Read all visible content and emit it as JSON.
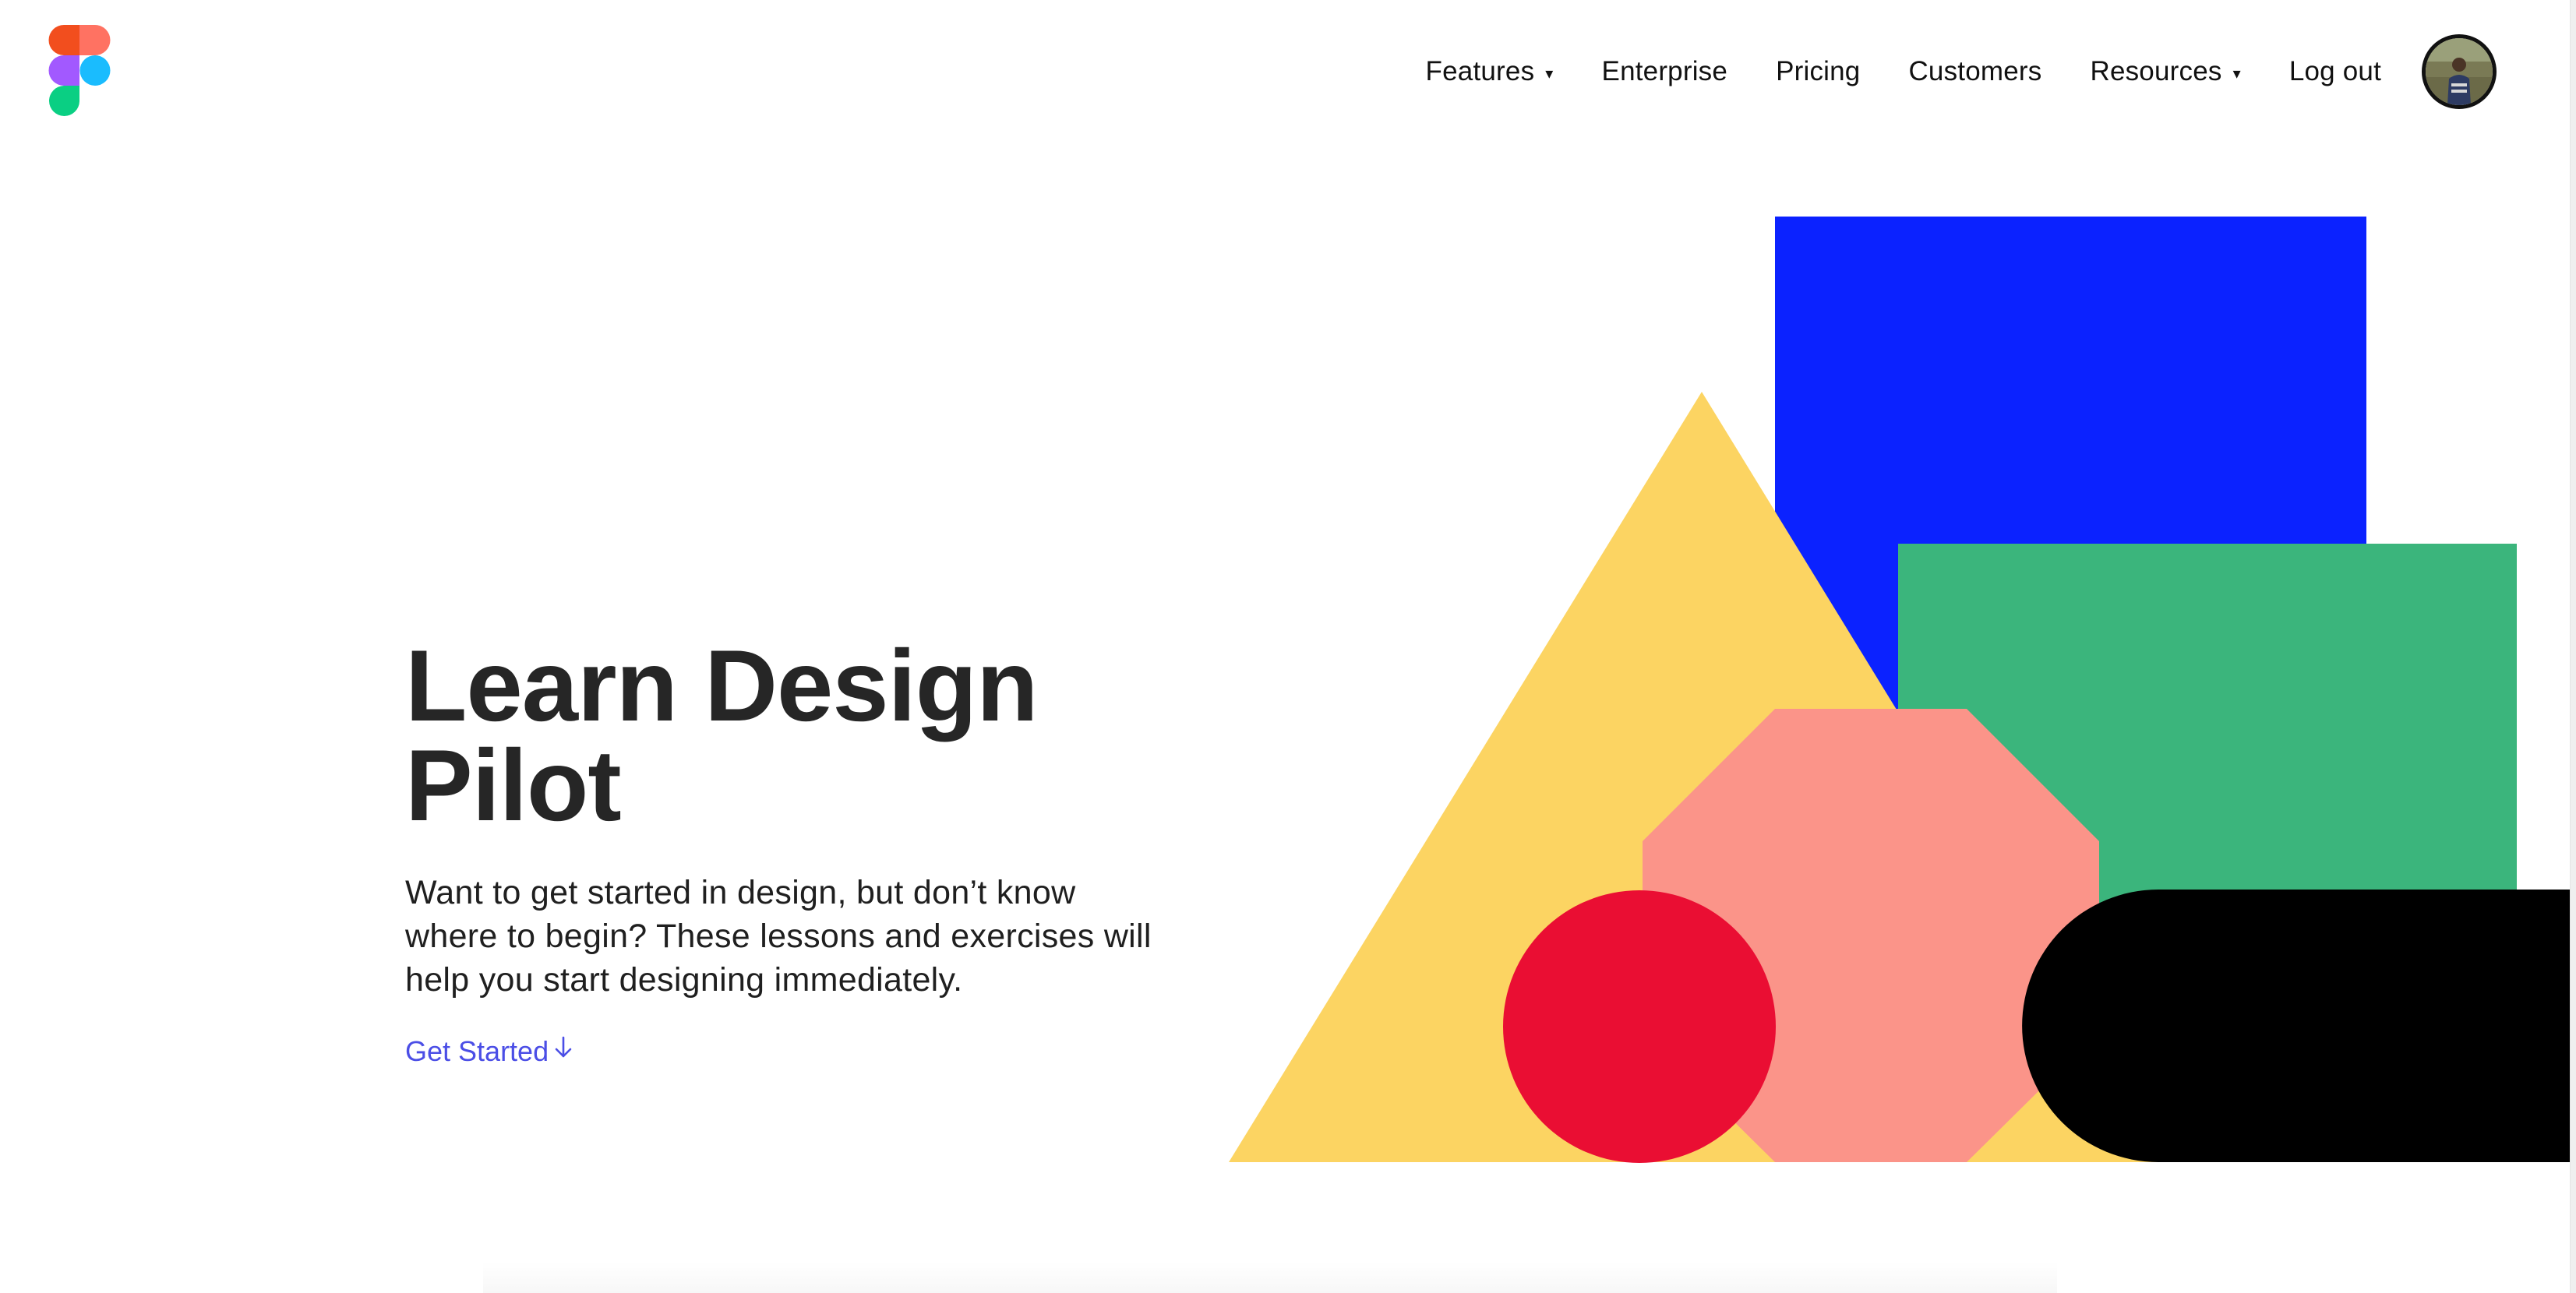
{
  "header": {
    "logo_icon": "figma-logo-icon",
    "nav": [
      {
        "label": "Features",
        "has_dropdown": true
      },
      {
        "label": "Enterprise",
        "has_dropdown": false
      },
      {
        "label": "Pricing",
        "has_dropdown": false
      },
      {
        "label": "Customers",
        "has_dropdown": false
      },
      {
        "label": "Resources",
        "has_dropdown": true
      },
      {
        "label": "Log out",
        "has_dropdown": false
      }
    ],
    "caret_glyph": "▾",
    "avatar_icon": "user-avatar-icon"
  },
  "hero": {
    "title_line1": "Learn Design",
    "title_line2": "Pilot",
    "subtitle_line1": "Want to get started in design, but don’t know",
    "subtitle_line2": "where to begin? These lessons and exercises will",
    "subtitle_line3": "help you start designing immediately.",
    "cta_label": "Get Started",
    "cta_icon": "arrow-down-icon"
  },
  "colors": {
    "blue": "#0b22ff",
    "green": "#3bb57c",
    "yellow": "#fcd462",
    "salmon": "#fb9489",
    "red": "#ea0e33",
    "black": "#000000",
    "link": "#4b4ee6",
    "text": "#262626"
  }
}
